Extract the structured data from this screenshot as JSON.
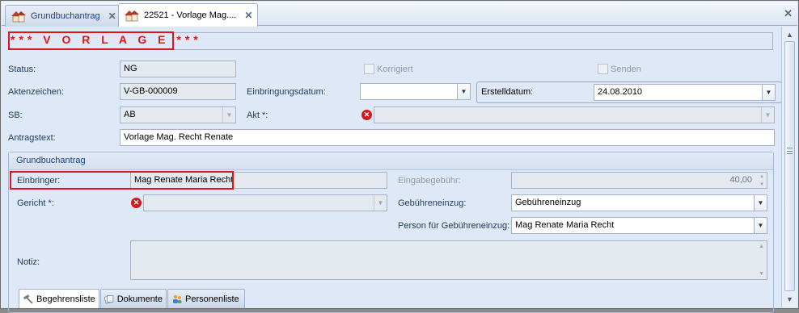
{
  "tabs": [
    {
      "label": "Grundbuchantrag",
      "active": false
    },
    {
      "label": "22521 - Vorlage Mag....",
      "active": true
    }
  ],
  "banner": {
    "text": "*** V O R L A G E ***",
    "color": "#e0151a"
  },
  "labels": {
    "status": "Status:",
    "aktenzeichen": "Aktenzeichen:",
    "sb": "SB:",
    "antragstext": "Antragstext:",
    "einbringungsdatum": "Einbringungsdatum:",
    "akt": "Akt *:",
    "erstelldatum": "Erstelldatum:"
  },
  "values": {
    "status": "NG",
    "aktenzeichen": "V-GB-000009",
    "sb": "AB",
    "antragstext": "Vorlage Mag. Recht Renate",
    "einbringungsdatum": "",
    "akt": "",
    "erstelldatum": "24.08.2010"
  },
  "checkboxes": {
    "korrigiert": {
      "label": "Korrigiert",
      "checked": false
    },
    "senden": {
      "label": "Senden",
      "checked": false
    }
  },
  "group": {
    "title": "Grundbuchantrag",
    "labels": {
      "einbringer": "Einbringer:",
      "gericht": "Gericht *:",
      "notiz": "Notiz:",
      "eingabegebuehr": "Eingabegebühr:",
      "gebuehreneinzug": "Gebühreneinzug:",
      "person_gebuehreneinzug": "Person für Gebühreneinzug:"
    },
    "values": {
      "einbringer": "Mag Renate Maria Recht",
      "gericht": "",
      "notiz": "",
      "eingabegebuehr": "40,00",
      "gebuehreneinzug": "Gebühreneinzug",
      "person_gebuehreneinzug": "Mag Renate Maria Recht"
    }
  },
  "bottom_tabs": [
    {
      "label": "Begehrensliste",
      "icon": "hammer-icon",
      "active": true
    },
    {
      "label": "Dokumente",
      "icon": "documents-icon",
      "active": false
    },
    {
      "label": "Personenliste",
      "icon": "people-icon",
      "active": false
    }
  ],
  "colors": {
    "accent": "#15428b",
    "error": "#d11a1a",
    "highlight": "#e0151a"
  }
}
